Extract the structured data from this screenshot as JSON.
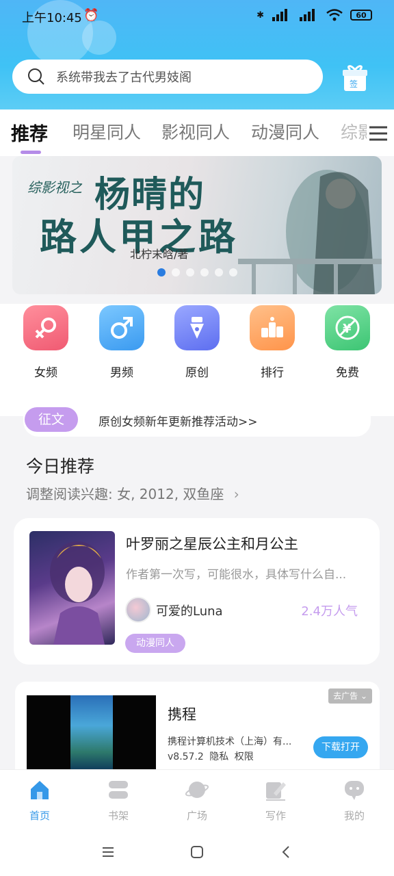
{
  "status_bar": {
    "time": "上午10:45",
    "battery": "60"
  },
  "search": {
    "placeholder": "系统带我去了古代男妓阁"
  },
  "tabs": [
    {
      "label": "推荐",
      "active": true
    },
    {
      "label": "明星同人",
      "active": false
    },
    {
      "label": "影视同人",
      "active": false
    },
    {
      "label": "动漫同人",
      "active": false
    },
    {
      "label": "综影",
      "active": false
    }
  ],
  "banner": {
    "line1": "综影视之",
    "line2": "杨晴的",
    "line3": "路人甲之路",
    "author": "北柠末晗/著",
    "slide_count": 6,
    "active_slide": 1
  },
  "categories": [
    {
      "label": "女频",
      "icon": "female-icon",
      "color": "#f46a7d"
    },
    {
      "label": "男频",
      "icon": "male-icon",
      "color": "#47a8f2"
    },
    {
      "label": "原创",
      "icon": "pen-nib-icon",
      "color": "#6c7cf0"
    },
    {
      "label": "排行",
      "icon": "ranking-icon",
      "color": "#ffa35c"
    },
    {
      "label": "免费",
      "icon": "free-icon",
      "color": "#45cf7e"
    }
  ],
  "notice": {
    "badge": "征文",
    "text": "原创女频新年更新推荐活动>>"
  },
  "today": {
    "title": "今日推荐",
    "subtitle": "调整阅读兴趣: 女, 2012, 双鱼座"
  },
  "recommend_book": {
    "title": "叶罗丽之星辰公主和月公主",
    "description": "作者第一次写，可能很水，具体写什么自...",
    "author": "可爱的Luna",
    "popularity": "2.4万人气",
    "tag": "动漫同人"
  },
  "ad": {
    "close_label": "去广告",
    "app_name": "携程",
    "company": "携程计算机技术（上海）有...",
    "meta": "v8.57.2  隐私  权限",
    "download": "下载打开"
  },
  "bottom_nav": [
    {
      "label": "首页",
      "icon": "home-icon",
      "active": true
    },
    {
      "label": "书架",
      "icon": "bookshelf-icon",
      "active": false
    },
    {
      "label": "广场",
      "icon": "planet-icon",
      "active": false
    },
    {
      "label": "写作",
      "icon": "write-icon",
      "active": false
    },
    {
      "label": "我的",
      "icon": "profile-icon",
      "active": false
    }
  ],
  "colors": {
    "header_blue": "#4fb6f6",
    "accent_purple": "#c59cee",
    "nav_active": "#3598e8"
  }
}
